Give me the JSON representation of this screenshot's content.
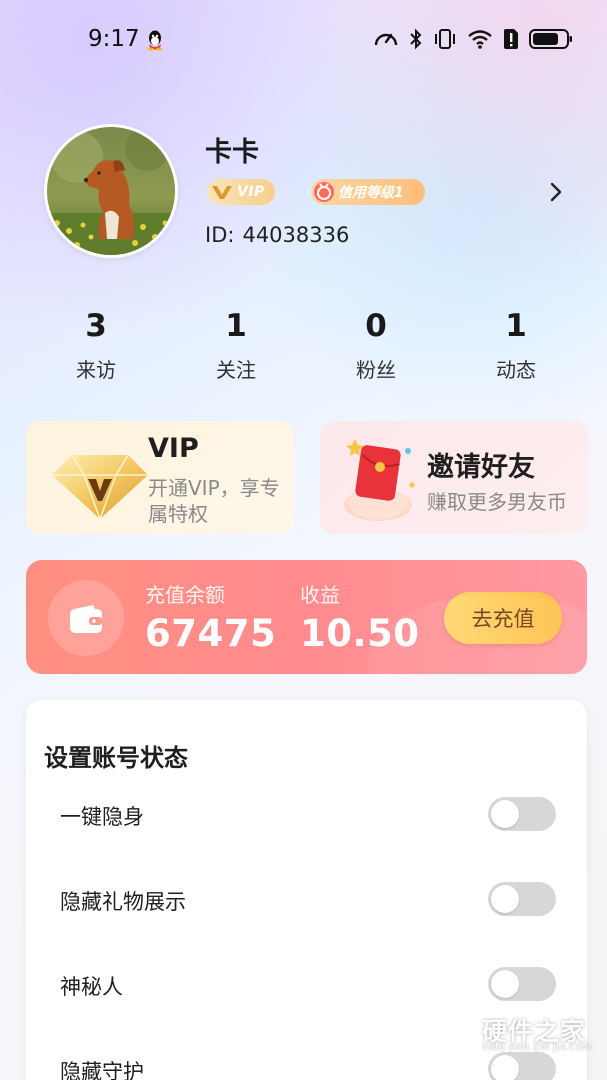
{
  "status_bar": {
    "time": "9:17",
    "icons": [
      "qq-icon",
      "data-speed-icon",
      "bluetooth-icon",
      "vibrate-icon",
      "wifi-icon",
      "sim-alert-icon",
      "battery-icon"
    ]
  },
  "profile": {
    "name": "卡卡",
    "vip_badge": "VIP",
    "credit_badge": "信用等级1",
    "id_label": "ID:",
    "id_value": "44038336"
  },
  "stats": [
    {
      "value": "3",
      "label": "来访"
    },
    {
      "value": "1",
      "label": "关注"
    },
    {
      "value": "0",
      "label": "粉丝"
    },
    {
      "value": "1",
      "label": "动态"
    }
  ],
  "promo": {
    "vip": {
      "title": "VIP",
      "desc": "开通VIP，享专属特权"
    },
    "invite": {
      "title": "邀请好友",
      "desc": "赚取更多男友币"
    }
  },
  "balance": {
    "recharge_label": "充值余额",
    "recharge_value": "67475",
    "income_label": "收益",
    "income_value": "10.50",
    "button": "去充值"
  },
  "settings": {
    "title": "设置账号状态",
    "items": [
      {
        "label": "一键隐身",
        "on": false
      },
      {
        "label": "隐藏礼物展示",
        "on": false
      },
      {
        "label": "神秘人",
        "on": false
      },
      {
        "label": "隐藏守护",
        "on": false
      }
    ]
  },
  "watermark": {
    "text": "硬件之家",
    "sub": "YING JIAN ZHI JIA.COM"
  },
  "colors": {
    "balance_card": "#ff8b8e",
    "recharge_button": "#ffc04a",
    "toggle_off": "#d7d7d7"
  }
}
